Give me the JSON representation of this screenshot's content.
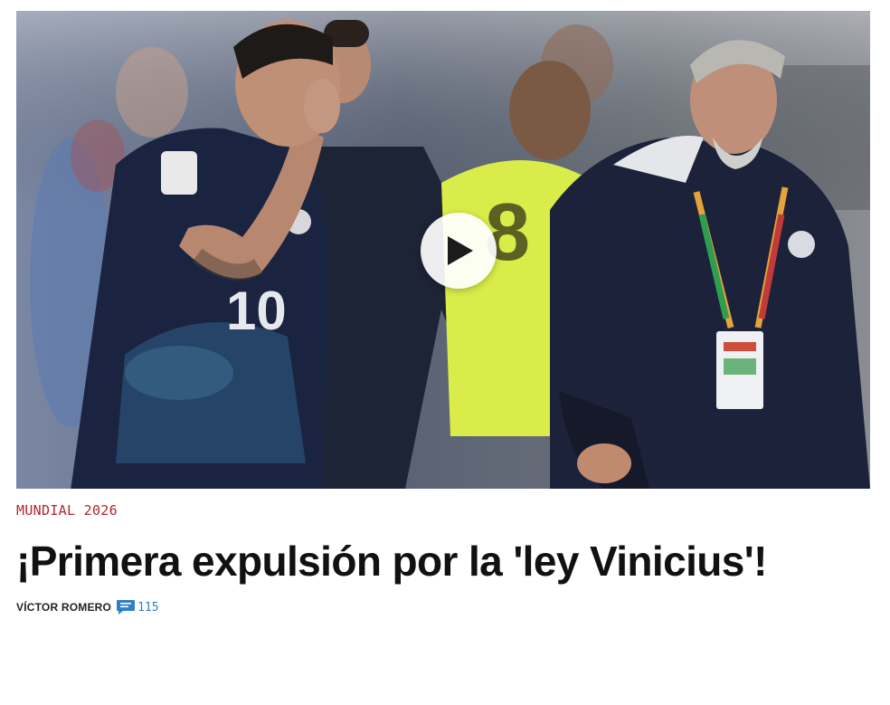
{
  "article": {
    "section": "MUNDIAL 2026",
    "headline": "¡Primera expulsión por la 'ley Vinicius'!",
    "author": "VÍCTOR ROMERO",
    "comment_count": "115"
  },
  "media": {
    "type": "video",
    "player_number": "10",
    "bib_number": "8"
  },
  "icons": {
    "play": "play-icon",
    "comments": "comment-bubble-icon"
  },
  "colors": {
    "section": "#b3262d",
    "headline": "#111111",
    "comment_accent": "#2f7fc8"
  }
}
